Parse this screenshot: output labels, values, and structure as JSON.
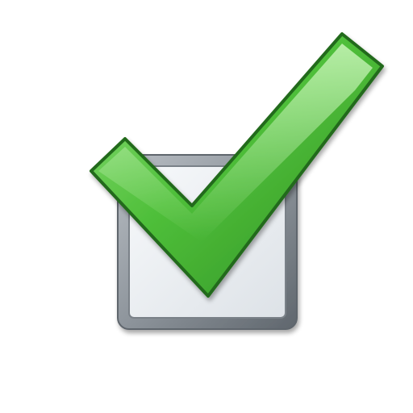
{
  "icon": {
    "name": "checked-checkbox-icon",
    "state": "checked",
    "colors": {
      "background": "#ffffff",
      "box_frame": "#8e959c",
      "box_frame_dark": "#5f666d",
      "box_inner": "#eef1f4",
      "check_fill_light": "#8fe07a",
      "check_fill_mid": "#4fbf3a",
      "check_fill_dark": "#2f8f22",
      "check_outline": "#246b1a"
    }
  }
}
